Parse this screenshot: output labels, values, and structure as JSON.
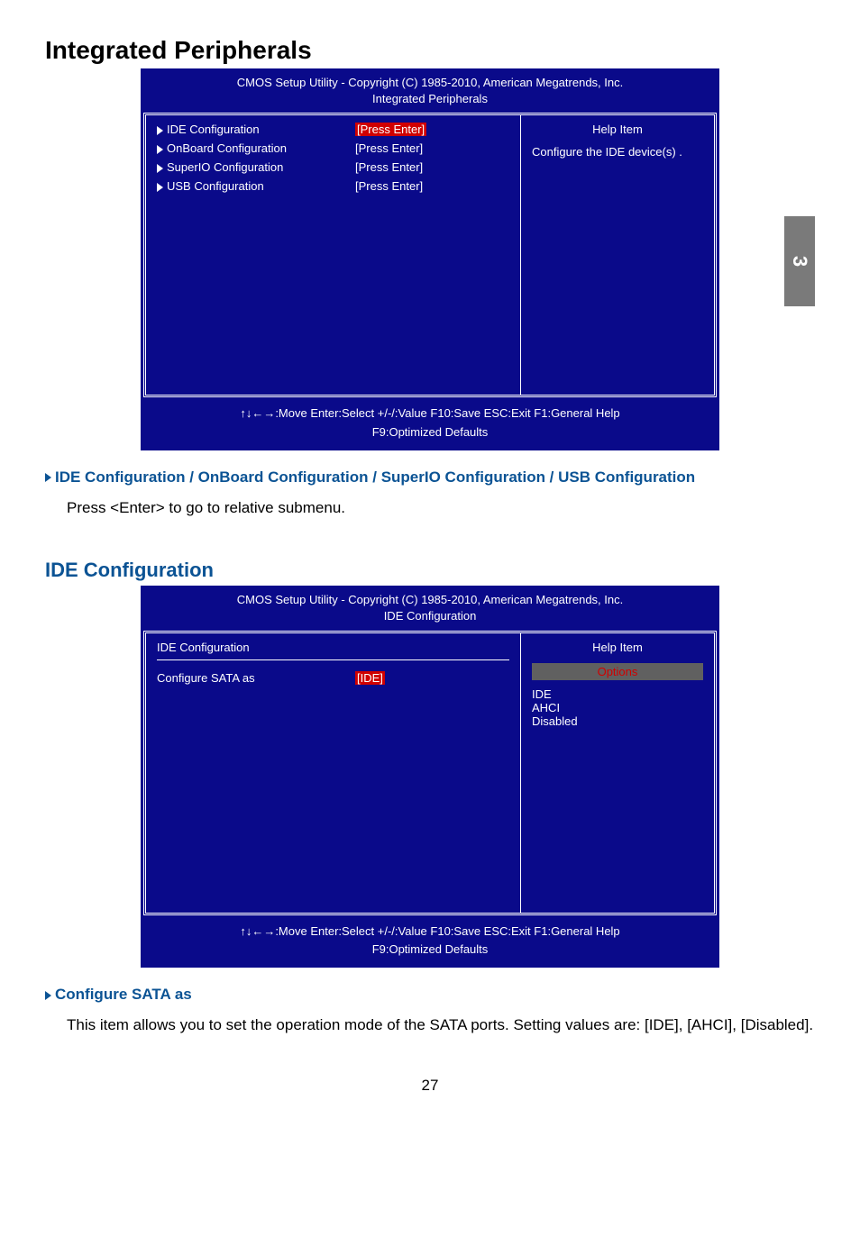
{
  "pageTab": "3",
  "pageNumber": "27",
  "section1": {
    "title": "Integrated Peripherals",
    "bios": {
      "headerLine1": "CMOS Setup Utility - Copyright (C) 1985-2010, American Megatrends, Inc.",
      "headerLine2": "Integrated Peripherals",
      "items": [
        {
          "label": "IDE Configuration",
          "value": "[Press Enter]",
          "selected": true
        },
        {
          "label": "OnBoard Configuration",
          "value": "[Press Enter]",
          "selected": false
        },
        {
          "label": "SuperIO Configuration",
          "value": "[Press Enter]",
          "selected": false
        },
        {
          "label": "USB Configuration",
          "value": "[Press Enter]",
          "selected": false
        }
      ],
      "help": {
        "title": "Help Item",
        "text": "Configure the IDE device(s) ."
      },
      "footerLine1": "↑↓←→:Move   Enter:Select     +/-/:Value     F10:Save     ESC:Exit     F1:General Help",
      "footerLine2": "F9:Optimized Defaults"
    },
    "item": {
      "head": "IDE Configuration / OnBoard Configuration / SuperIO Configuration / USB Configuration",
      "body": "Press <Enter> to go to relative submenu."
    }
  },
  "section2": {
    "title": "IDE Configuration",
    "bios": {
      "headerLine1": "CMOS Setup Utility - Copyright (C) 1985-2010, American Megatrends, Inc.",
      "headerLine2": "IDE Configuration",
      "topRow": "IDE Configuration",
      "items": [
        {
          "label": "Configure SATA as",
          "value": "[IDE]",
          "selected": true
        }
      ],
      "help": {
        "title": "Help Item",
        "optionsLabel": "Options",
        "options": [
          "IDE",
          "AHCI",
          "Disabled"
        ]
      },
      "footerLine1": "↑↓←→:Move   Enter:Select     +/-/:Value     F10:Save     ESC:Exit     F1:General Help",
      "footerLine2": "F9:Optimized Defaults"
    },
    "item": {
      "head": "Configure SATA as",
      "body": "This item allows you to set the operation mode of the SATA ports. Setting values are: [IDE], [AHCI], [Disabled]."
    }
  }
}
